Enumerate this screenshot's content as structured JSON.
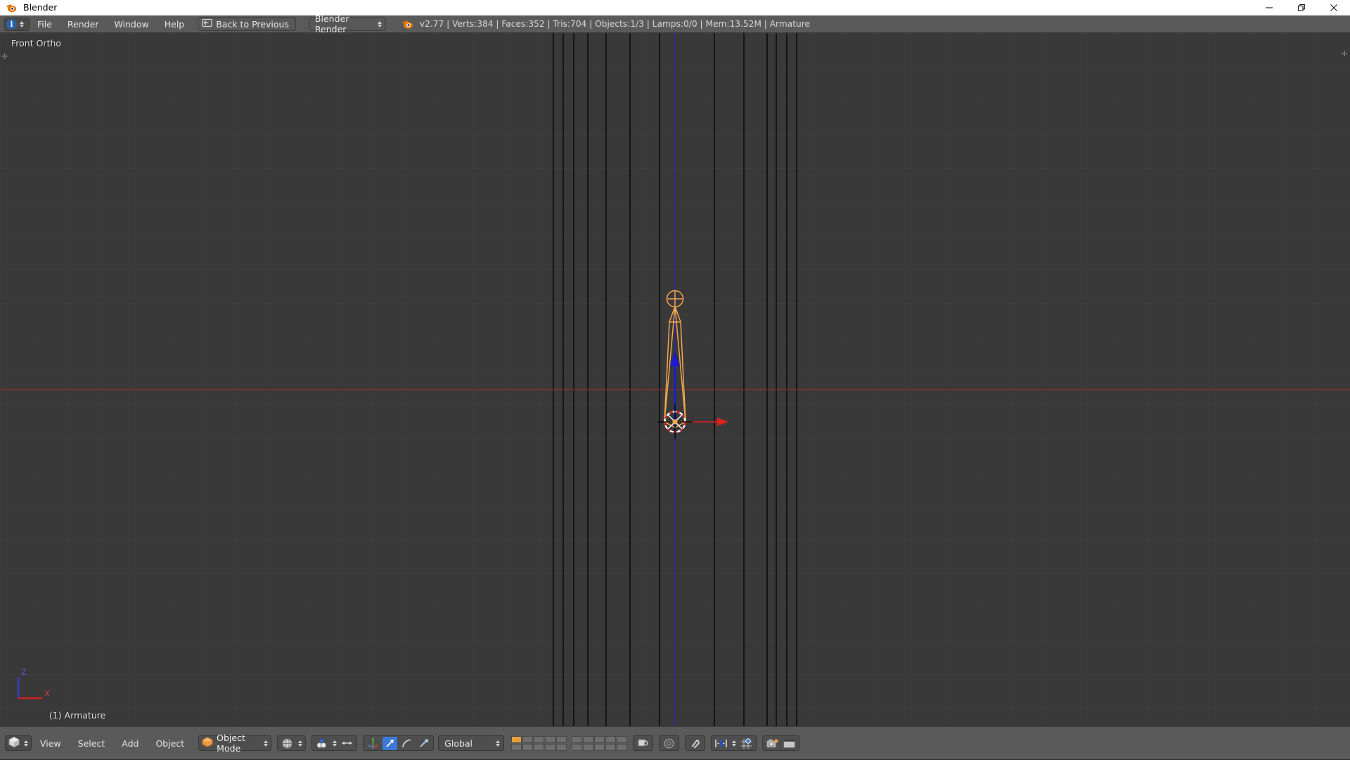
{
  "window": {
    "title": "Blender",
    "app_icon": "blender-logo-icon",
    "controls": [
      {
        "name": "minimize-button",
        "glyph": "minimize-icon"
      },
      {
        "name": "maximize-button",
        "glyph": "maximize-icon"
      },
      {
        "name": "close-button",
        "glyph": "close-icon"
      }
    ]
  },
  "topbar": {
    "editor_type_icon": "info-editor-icon",
    "menus": [
      {
        "label": "File"
      },
      {
        "label": "Render"
      },
      {
        "label": "Window"
      },
      {
        "label": "Help"
      }
    ],
    "back_button": {
      "label": "Back to Previous",
      "icon": "back-arrow-icon"
    },
    "render_engine": {
      "label": "Blender Render",
      "icon": "chevron-updown-icon"
    },
    "blender_icon": "blender-logo-icon",
    "stats": "v2.77 | Verts:384 | Faces:352 | Tris:704 | Objects:1/3 | Lamps:0/0 | Mem:13.52M | Armature",
    "stats_parts": {
      "version": "v2.77",
      "verts": "Verts:384",
      "faces": "Faces:352",
      "tris": "Tris:704",
      "objects": "Objects:1/3",
      "lamps": "Lamps:0/0",
      "mem": "Mem:13.52M",
      "active_object": "Armature"
    }
  },
  "viewport": {
    "view_name": "Front Ortho",
    "object_name": "(1) Armature",
    "axis_gizmo": {
      "z_label": "Z",
      "x_label": "X",
      "z_color": "#3b3bd0",
      "x_color": "#cc2222"
    },
    "colors": {
      "background": "#393939",
      "grid_fine": "#3f3f3f",
      "grid_bold": "#0a0a0a",
      "axis_x": "#a03030",
      "axis_z": "#2a2a8c",
      "bone_outline": "#f3a54a",
      "cursor_ring": "#ffffff",
      "cursor_dash": "#d02020"
    },
    "corner_handles": [
      "top-left-plus",
      "top-right-plus"
    ]
  },
  "bottombar": {
    "editor_type_icon": "3d-view-editor-icon",
    "menus": [
      {
        "label": "View"
      },
      {
        "label": "Select"
      },
      {
        "label": "Add"
      },
      {
        "label": "Object"
      }
    ],
    "mode": {
      "label": "Object Mode",
      "icon": "object-mode-cube-icon"
    },
    "viewport_shading_icon": "shading-solid-icon",
    "pivot_icon": "pivot-median-point-icon",
    "snap_to_icon": "snap-magnet-icon",
    "proportional_icon": "proportional-edit-icon",
    "manipulator_buttons": [
      {
        "name": "manipulator-toggle-icon",
        "active": false
      },
      {
        "name": "translate-manipulator-icon",
        "active": true
      },
      {
        "name": "rotate-manipulator-icon",
        "active": false
      },
      {
        "name": "scale-manipulator-icon",
        "active": false
      }
    ],
    "transform_orientation": {
      "label": "Global",
      "icon": "chevron-updown-icon"
    },
    "layers": {
      "top_row_active_index": 0,
      "rows": 2,
      "cols": 5,
      "groups": 2
    },
    "right_icons": [
      {
        "name": "lock-object-modes-icon"
      },
      {
        "name": "render-preview-icon"
      },
      {
        "name": "snap-magnet-icon"
      },
      {
        "name": "snap-element-icon"
      },
      {
        "name": "snap-target-icon"
      },
      {
        "name": "opengl-render-image-icon"
      },
      {
        "name": "opengl-render-animation-icon"
      }
    ]
  }
}
